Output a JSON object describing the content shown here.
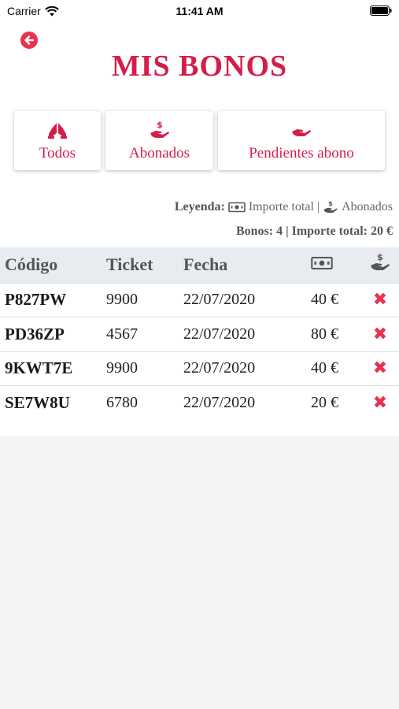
{
  "status_bar": {
    "carrier": "Carrier",
    "time": "11:41 AM"
  },
  "header": {
    "title": "MIS BONOS"
  },
  "filters": [
    {
      "label": "Todos",
      "icon": "hands-icon"
    },
    {
      "label": "Abonados",
      "icon": "hand-dollar-icon"
    },
    {
      "label": "Pendientes abono",
      "icon": "hand-icon"
    }
  ],
  "legend": {
    "prefix": "Leyenda:",
    "total_label": "Importe total",
    "separator": "|",
    "paid_label": "Abonados"
  },
  "summary": {
    "text": "Bonos: 4 | Importe total: 20 €"
  },
  "table": {
    "columns": [
      "Código",
      "Ticket",
      "Fecha"
    ],
    "rows": [
      {
        "code": "P827PW",
        "ticket": "9900",
        "date": "22/07/2020",
        "amount": "40 €"
      },
      {
        "code": "PD36ZP",
        "ticket": "4567",
        "date": "22/07/2020",
        "amount": "80 €"
      },
      {
        "code": "9KWT7E",
        "ticket": "9900",
        "date": "22/07/2020",
        "amount": "40 €"
      },
      {
        "code": "SE7W8U",
        "ticket": "6780",
        "date": "22/07/2020",
        "amount": "20 €"
      }
    ],
    "delete_glyph": "✖"
  },
  "colors": {
    "accent": "#d41e4a",
    "back_button": "#e8324f",
    "header_row": "#e8ebef"
  }
}
